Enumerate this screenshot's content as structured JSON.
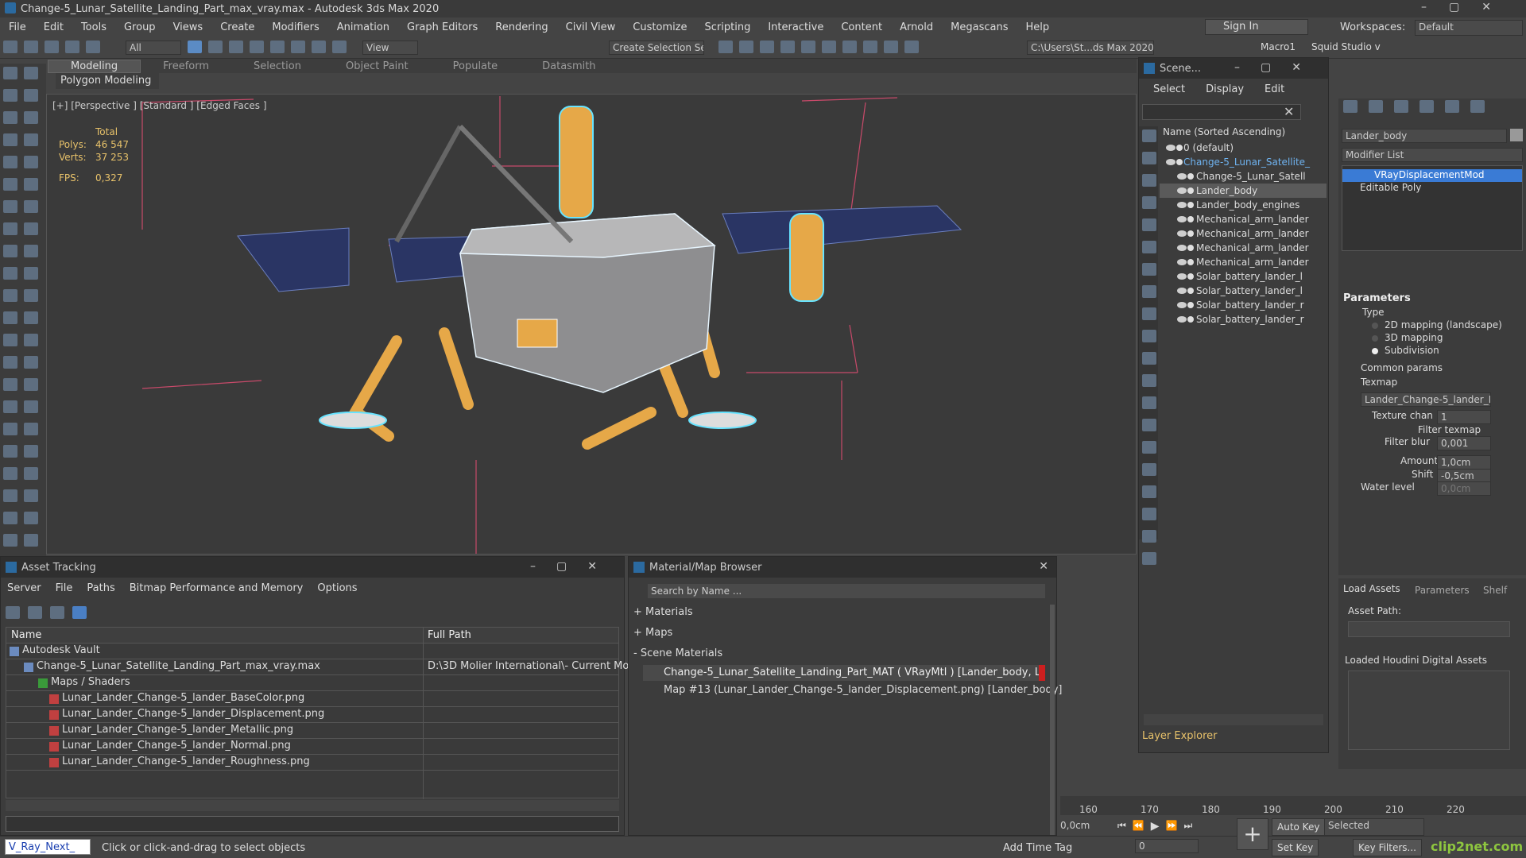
{
  "window": {
    "title": "Change-5_Lunar_Satellite_Landing_Part_max_vray.max - Autodesk 3ds Max 2020"
  },
  "menu": [
    "File",
    "Edit",
    "Tools",
    "Group",
    "Views",
    "Create",
    "Modifiers",
    "Animation",
    "Graph Editors",
    "Rendering",
    "Civil View",
    "Customize",
    "Scripting",
    "Interactive",
    "Content",
    "Arnold",
    "Megascans",
    "Help"
  ],
  "account": {
    "signin": "Sign In",
    "workspaces_label": "Workspaces:",
    "workspace": "Default"
  },
  "toolbar": {
    "filter": "All",
    "view": "View",
    "selection_set": "Create Selection Se",
    "path": "C:\\Users\\St...ds Max 2020",
    "macro": "Macro1",
    "squid": "Squid Studio v"
  },
  "ribbon": {
    "tabs": [
      "Modeling",
      "Freeform",
      "Selection",
      "Object Paint",
      "Populate",
      "Datasmith"
    ],
    "active": "Modeling",
    "sub": "Polygon Modeling"
  },
  "viewport": {
    "label": "[+] [Perspective ] [Standard ] [Edged Faces ]",
    "stats": {
      "total_label": "Total",
      "polys_label": "Polys:",
      "polys": "46 547",
      "verts_label": "Verts:",
      "verts": "37 253",
      "fps_label": "FPS:",
      "fps": "0,327"
    }
  },
  "scene_explorer": {
    "title": "Scene...",
    "menu": [
      "Select",
      "Display",
      "Edit"
    ],
    "header": "Name (Sorted Ascending)",
    "rows": [
      {
        "name": "0 (default)",
        "indent": 0
      },
      {
        "name": "Change-5_Lunar_Satellite_",
        "indent": 0
      },
      {
        "name": "Change-5_Lunar_Satell",
        "indent": 1
      },
      {
        "name": "Lander_body",
        "indent": 1
      },
      {
        "name": "Lander_body_engines",
        "indent": 1
      },
      {
        "name": "Mechanical_arm_lander",
        "indent": 1
      },
      {
        "name": "Mechanical_arm_lander",
        "indent": 1
      },
      {
        "name": "Mechanical_arm_lander",
        "indent": 1
      },
      {
        "name": "Mechanical_arm_lander",
        "indent": 1
      },
      {
        "name": "Solar_battery_lander_l",
        "indent": 1
      },
      {
        "name": "Solar_battery_lander_l",
        "indent": 1
      },
      {
        "name": "Solar_battery_lander_r",
        "indent": 1
      },
      {
        "name": "Solar_battery_lander_r",
        "indent": 1
      }
    ],
    "footer": "Layer Explorer"
  },
  "command_panel": {
    "object_name": "Lander_body",
    "modifier_list": "Modifier List",
    "stack": [
      "VRayDisplacementMod",
      "Editable Poly"
    ],
    "params_title": "Parameters",
    "type_label": "Type",
    "types": [
      "2D mapping (landscape)",
      "3D mapping",
      "Subdivision"
    ],
    "type_selected": "Subdivision",
    "common": "Common params",
    "texmap_label": "Texmap",
    "texmap": "Lander_Change-5_lander_De",
    "texture_chan_label": "Texture chan",
    "texture_chan": "1",
    "filter_texmap": "Filter texmap",
    "filter_blur_label": "Filter blur",
    "filter_blur": "0,001",
    "amount_label": "Amount",
    "amount": "1,0cm",
    "shift_label": "Shift",
    "shift": "-0,5cm",
    "water_label": "Water level",
    "water": "0,0cm",
    "tabs": [
      "Load Assets",
      "Parameters",
      "Shelf"
    ],
    "asset_path": "Asset Path:",
    "loaded_houdini": "Loaded Houdini Digital Assets"
  },
  "asset_tracking": {
    "title": "Asset Tracking",
    "menu": [
      "Server",
      "File",
      "Paths",
      "Bitmap Performance and Memory",
      "Options"
    ],
    "col_name": "Name",
    "col_path": "Full Path",
    "rows": [
      {
        "name": "Autodesk Vault",
        "path": ""
      },
      {
        "name": "Change-5_Lunar_Satellite_Landing_Part_max_vray.max",
        "path": "D:\\3D Molier International\\- Current Mo"
      },
      {
        "name": "Maps / Shaders",
        "path": ""
      },
      {
        "name": "Lunar_Lander_Change-5_lander_BaseColor.png",
        "path": ""
      },
      {
        "name": "Lunar_Lander_Change-5_lander_Displacement.png",
        "path": ""
      },
      {
        "name": "Lunar_Lander_Change-5_lander_Metallic.png",
        "path": ""
      },
      {
        "name": "Lunar_Lander_Change-5_lander_Normal.png",
        "path": ""
      },
      {
        "name": "Lunar_Lander_Change-5_lander_Roughness.png",
        "path": ""
      }
    ]
  },
  "material_browser": {
    "title": "Material/Map Browser",
    "search": "Search by Name ...",
    "sections": [
      "+ Materials",
      "+ Maps",
      "- Scene Materials"
    ],
    "items": [
      "Change-5_Lunar_Satellite_Landing_Part_MAT ( VRayMtl ) [Lander_body, Lande...",
      "Map #13 (Lunar_Lander_Change-5_lander_Displacement.png) [Lander_body]"
    ]
  },
  "timeline": {
    "ticks": [
      "160",
      "170",
      "180",
      "190",
      "200",
      "210",
      "220"
    ]
  },
  "status": {
    "script": "V_Ray_Next_",
    "prompt": "Click or click-and-drag to select objects",
    "add_time_tag": "Add Time Tag",
    "coord": "0,0cm",
    "frame": "0",
    "auto_key": "Auto Key",
    "selected": "Selected",
    "set_key": "Set Key",
    "key_filters": "Key Filters...",
    "watermark": "clip2net.com"
  },
  "colors": {
    "accent": "#4a90d9",
    "highlight": "#e8c26a",
    "selection_blue": "#3a7bd5",
    "error_red": "#cc1f1f"
  }
}
